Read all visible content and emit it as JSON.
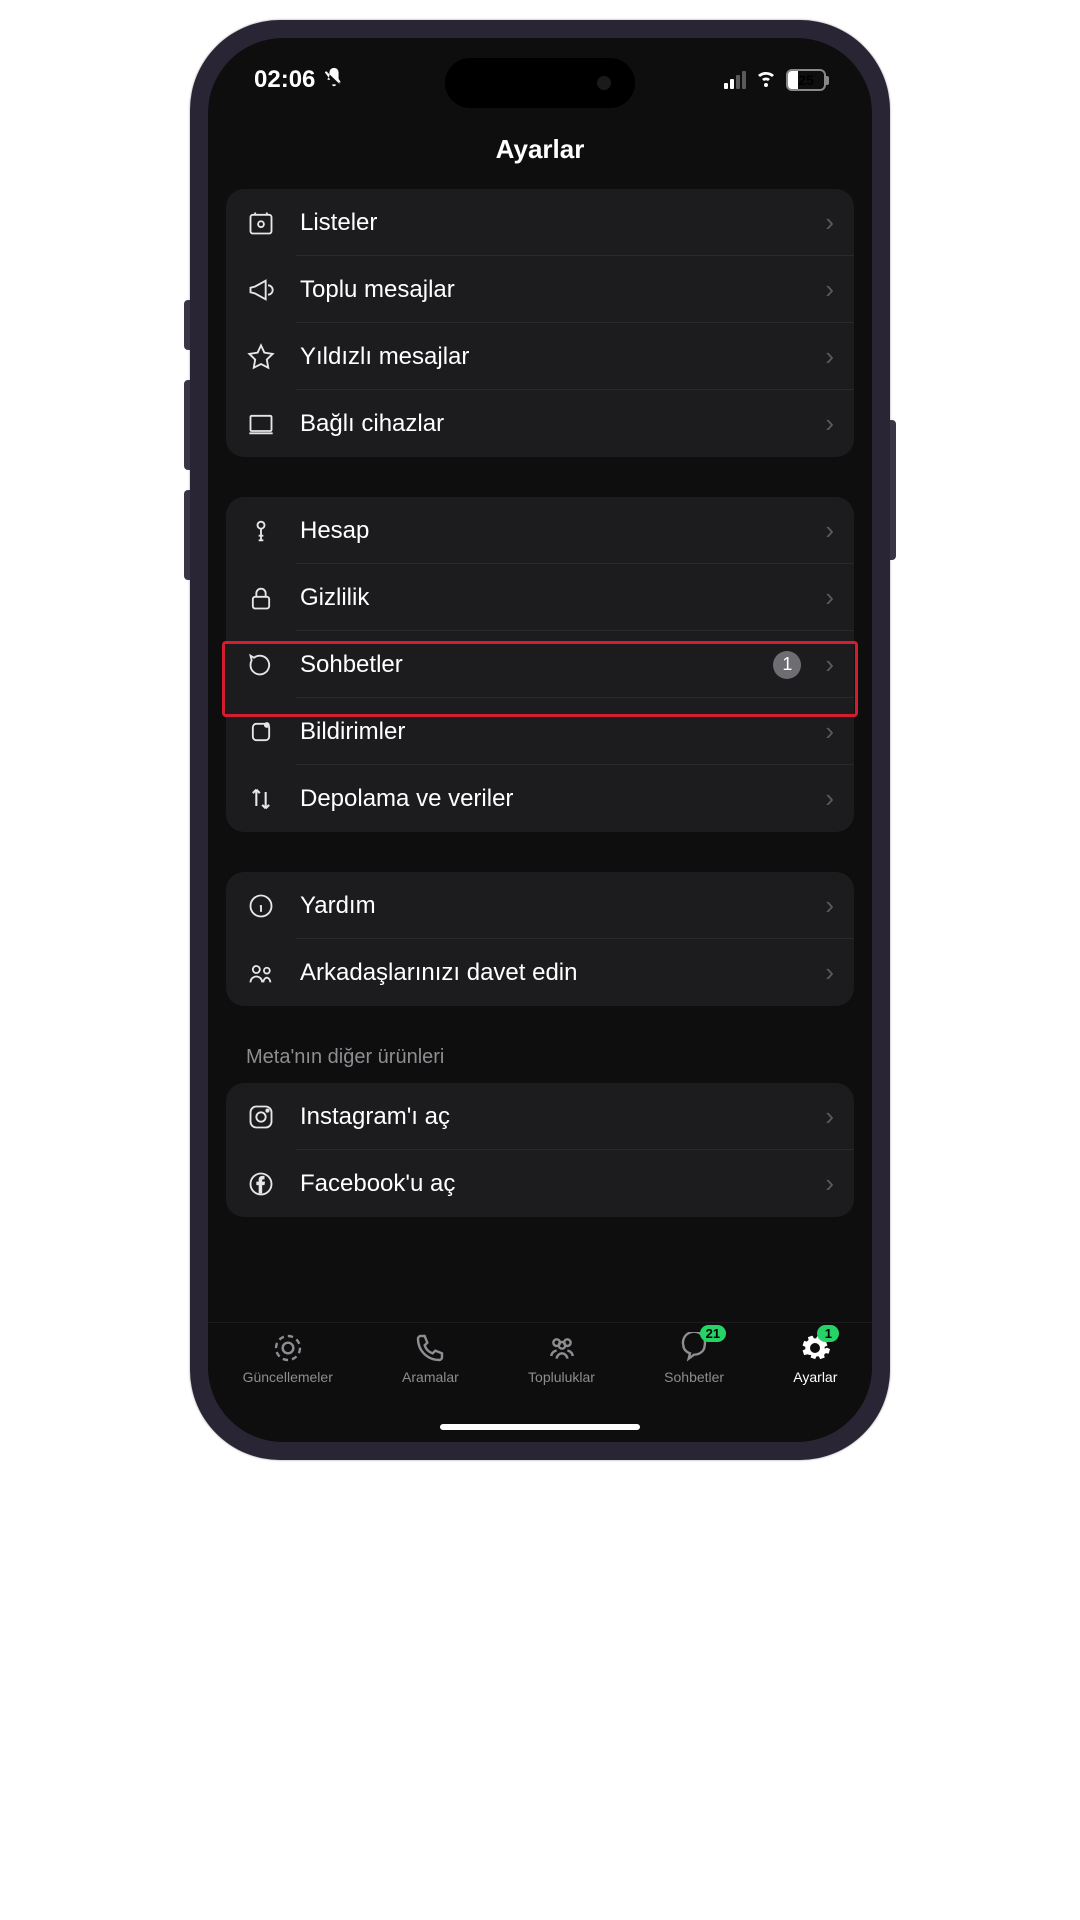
{
  "status": {
    "time": "02:06",
    "battery": "25"
  },
  "header": {
    "title": "Ayarlar"
  },
  "section1": {
    "items": [
      {
        "label": "Listeler"
      },
      {
        "label": "Toplu mesajlar"
      },
      {
        "label": "Yıldızlı mesajlar"
      },
      {
        "label": "Bağlı cihazlar"
      }
    ]
  },
  "section2": {
    "items": [
      {
        "label": "Hesap"
      },
      {
        "label": "Gizlilik"
      },
      {
        "label": "Sohbetler",
        "badge": "1"
      },
      {
        "label": "Bildirimler"
      },
      {
        "label": "Depolama ve veriler"
      }
    ]
  },
  "section3": {
    "items": [
      {
        "label": "Yardım"
      },
      {
        "label": "Arkadaşlarınızı davet edin"
      }
    ]
  },
  "section4": {
    "label": "Meta'nın diğer ürünleri",
    "items": [
      {
        "label": "Instagram'ı aç"
      },
      {
        "label": "Facebook'u aç"
      }
    ]
  },
  "tabs": {
    "items": [
      {
        "label": "Güncellemeler"
      },
      {
        "label": "Aramalar"
      },
      {
        "label": "Topluluklar"
      },
      {
        "label": "Sohbetler",
        "badge": "21"
      },
      {
        "label": "Ayarlar",
        "badge": "1"
      }
    ]
  }
}
